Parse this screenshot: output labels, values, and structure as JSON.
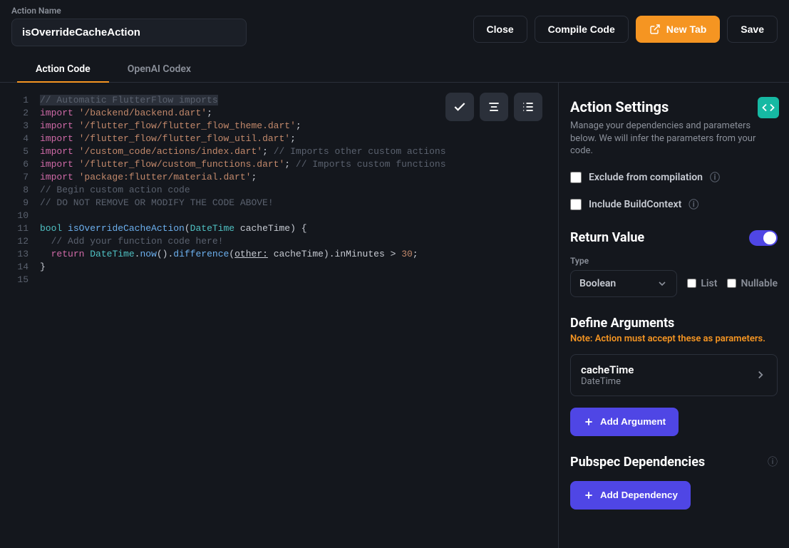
{
  "header": {
    "action_name_label": "Action Name",
    "action_name_value": "isOverrideCacheAction",
    "close": "Close",
    "compile": "Compile Code",
    "new_tab": "New Tab",
    "save": "Save"
  },
  "tabs": {
    "code": "Action Code",
    "codex": "OpenAI Codex"
  },
  "code_lines": [
    {
      "n": 1,
      "bg": true,
      "tokens": [
        [
          "comment",
          "// Automatic FlutterFlow imports"
        ]
      ]
    },
    {
      "n": 2,
      "tokens": [
        [
          "kw",
          "import"
        ],
        [
          "default",
          " "
        ],
        [
          "str",
          "'/backend/backend.dart'"
        ],
        [
          "default",
          ";"
        ]
      ]
    },
    {
      "n": 3,
      "tokens": [
        [
          "kw",
          "import"
        ],
        [
          "default",
          " "
        ],
        [
          "str",
          "'/flutter_flow/flutter_flow_theme.dart'"
        ],
        [
          "default",
          ";"
        ]
      ]
    },
    {
      "n": 4,
      "tokens": [
        [
          "kw",
          "import"
        ],
        [
          "default",
          " "
        ],
        [
          "str",
          "'/flutter_flow/flutter_flow_util.dart'"
        ],
        [
          "default",
          ";"
        ]
      ]
    },
    {
      "n": 5,
      "tokens": [
        [
          "kw",
          "import"
        ],
        [
          "default",
          " "
        ],
        [
          "str",
          "'/custom_code/actions/index.dart'"
        ],
        [
          "default",
          "; "
        ],
        [
          "comment",
          "// Imports other custom actions"
        ]
      ]
    },
    {
      "n": 6,
      "tokens": [
        [
          "kw",
          "import"
        ],
        [
          "default",
          " "
        ],
        [
          "str",
          "'/flutter_flow/custom_functions.dart'"
        ],
        [
          "default",
          "; "
        ],
        [
          "comment",
          "// Imports custom functions"
        ]
      ]
    },
    {
      "n": 7,
      "tokens": [
        [
          "kw",
          "import"
        ],
        [
          "default",
          " "
        ],
        [
          "str",
          "'package:flutter/material.dart'"
        ],
        [
          "default",
          ";"
        ]
      ]
    },
    {
      "n": 8,
      "tokens": [
        [
          "comment",
          "// Begin custom action code"
        ]
      ]
    },
    {
      "n": 9,
      "tokens": [
        [
          "comment",
          "// DO NOT REMOVE OR MODIFY THE CODE ABOVE!"
        ]
      ]
    },
    {
      "n": 10,
      "tokens": [
        [
          "default",
          ""
        ]
      ]
    },
    {
      "n": 11,
      "tokens": [
        [
          "type",
          "bool"
        ],
        [
          "default",
          " "
        ],
        [
          "fn",
          "isOverrideCacheAction"
        ],
        [
          "default",
          "("
        ],
        [
          "type",
          "DateTime"
        ],
        [
          "default",
          " cacheTime) {"
        ]
      ]
    },
    {
      "n": 12,
      "tokens": [
        [
          "default",
          "  "
        ],
        [
          "comment",
          "// Add your function code here!"
        ]
      ]
    },
    {
      "n": 13,
      "tokens": [
        [
          "default",
          "  "
        ],
        [
          "kw",
          "return"
        ],
        [
          "default",
          " "
        ],
        [
          "type",
          "DateTime"
        ],
        [
          "default",
          "."
        ],
        [
          "fn",
          "now"
        ],
        [
          "default",
          "()."
        ],
        [
          "fn",
          "difference"
        ],
        [
          "default",
          "("
        ],
        [
          "param",
          "other:"
        ],
        [
          "default",
          " cacheTime).inMinutes "
        ],
        [
          "op",
          ">"
        ],
        [
          "default",
          " "
        ],
        [
          "num",
          "30"
        ],
        [
          "default",
          ";"
        ]
      ]
    },
    {
      "n": 14,
      "tokens": [
        [
          "default",
          "}"
        ]
      ]
    },
    {
      "n": 15,
      "tokens": [
        [
          "default",
          ""
        ]
      ]
    }
  ],
  "side": {
    "title": "Action Settings",
    "subtitle": "Manage your dependencies and parameters below. We will infer the parameters from your code.",
    "exclude": "Exclude from compilation",
    "include_ctx": "Include BuildContext",
    "return_value": "Return Value",
    "type_label": "Type",
    "type_value": "Boolean",
    "list_label": "List",
    "nullable_label": "Nullable",
    "define_args": "Define Arguments",
    "note": "Note: Action must accept these as parameters.",
    "arg_name": "cacheTime",
    "arg_type": "DateTime",
    "add_arg": "Add Argument",
    "pubspec": "Pubspec Dependencies",
    "add_dep": "Add Dependency"
  }
}
